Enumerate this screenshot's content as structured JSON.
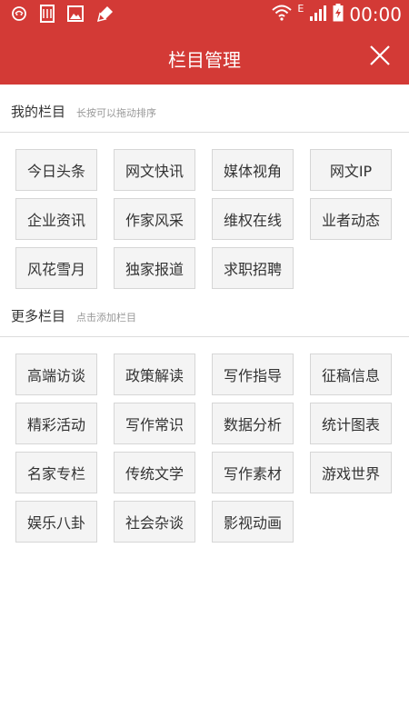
{
  "status_bar": {
    "time": "00:00",
    "network_type": "E",
    "icons_left": [
      "notification-icon",
      "sim-card-icon",
      "gallery-icon",
      "brush-icon"
    ],
    "icons_right": [
      "wifi-icon",
      "signal-icon",
      "battery-charging-icon"
    ]
  },
  "header": {
    "title": "栏目管理",
    "close_icon": "close-icon"
  },
  "my_columns": {
    "title": "我的栏目",
    "hint": "长按可以拖动排序",
    "items": [
      "今日头条",
      "网文快讯",
      "媒体视角",
      "网文IP",
      "企业资讯",
      "作家风采",
      "维权在线",
      "业者动态",
      "风花雪月",
      "独家报道",
      "求职招聘"
    ]
  },
  "more_columns": {
    "title": "更多栏目",
    "hint": "点击添加栏目",
    "items": [
      "高端访谈",
      "政策解读",
      "写作指导",
      "征稿信息",
      "精彩活动",
      "写作常识",
      "数据分析",
      "统计图表",
      "名家专栏",
      "传统文学",
      "写作素材",
      "游戏世界",
      "娱乐八卦",
      "社会杂谈",
      "影视动画"
    ]
  },
  "colors": {
    "primary": "#d33a36",
    "chip_bg": "#f4f4f4",
    "chip_border": "#d6d6d6",
    "hint_text": "#999999"
  }
}
